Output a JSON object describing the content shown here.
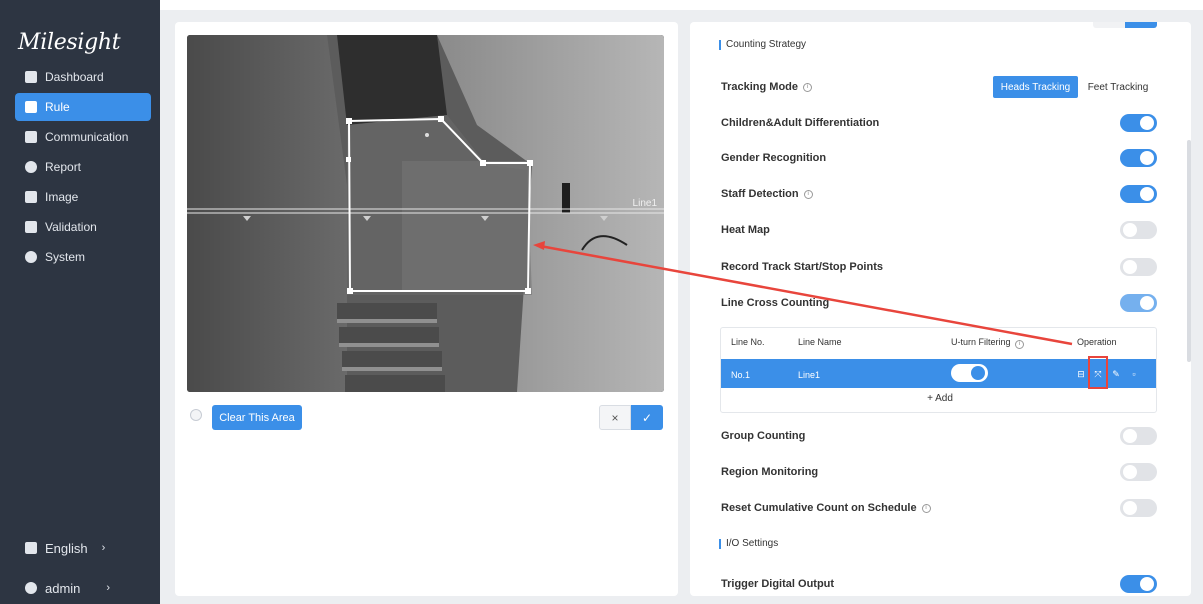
{
  "sidebar": {
    "logo": "Milesight",
    "items": [
      {
        "label": "Dashboard",
        "icon": "dashboard-icon",
        "active": false
      },
      {
        "label": "Rule",
        "icon": "rule-icon",
        "active": true
      },
      {
        "label": "Communication",
        "icon": "communication-icon",
        "active": false
      },
      {
        "label": "Report",
        "icon": "report-icon",
        "active": false
      },
      {
        "label": "Image",
        "icon": "image-icon",
        "active": false
      },
      {
        "label": "Validation",
        "icon": "validation-icon",
        "active": false
      },
      {
        "label": "System",
        "icon": "system-icon",
        "active": false
      }
    ],
    "language": {
      "label": "English",
      "icon": "language-icon"
    },
    "user": {
      "label": "admin",
      "icon": "user-icon"
    }
  },
  "video": {
    "line_label": "Line1",
    "clear_area_label": "Clear This Area",
    "cancel_symbol": "×",
    "confirm_symbol": "✓"
  },
  "settings": {
    "counting_strategy_title": "Counting Strategy",
    "tracking_mode": {
      "label": "Tracking Mode",
      "options": [
        "Heads Tracking",
        "Feet Tracking"
      ],
      "selected": "Heads Tracking"
    },
    "rows": [
      {
        "key": "children_adult",
        "label": "Children&Adult Differentiation",
        "on": true,
        "info": false
      },
      {
        "key": "gender",
        "label": "Gender Recognition",
        "on": true,
        "info": false
      },
      {
        "key": "staff",
        "label": "Staff Detection",
        "on": true,
        "info": true
      },
      {
        "key": "heatmap",
        "label": "Heat Map",
        "on": false,
        "info": false
      },
      {
        "key": "record_track",
        "label": "Record Track Start/Stop Points",
        "on": false,
        "info": false
      },
      {
        "key": "line_cross",
        "label": "Line Cross Counting",
        "on": true,
        "info": false
      }
    ],
    "line_table": {
      "headers": [
        "Line No.",
        "Line Name",
        "U-turn Filtering",
        "Operation"
      ],
      "rows": [
        {
          "no": "No.1",
          "name": "Line1",
          "uturn": true
        }
      ],
      "add_label": "+ Add"
    },
    "rows_after": [
      {
        "key": "group",
        "label": "Group Counting",
        "on": false,
        "info": false
      },
      {
        "key": "region",
        "label": "Region Monitoring",
        "on": false,
        "info": false
      },
      {
        "key": "reset",
        "label": "Reset Cumulative Count on Schedule",
        "on": false,
        "info": true
      }
    ],
    "io_settings_title": "I/O Settings",
    "trigger_output": {
      "label": "Trigger Digital Output",
      "on": true
    }
  },
  "colors": {
    "accent": "#3b8fe8",
    "sidebar_bg": "#2d3542",
    "highlight": "#e8453c"
  }
}
